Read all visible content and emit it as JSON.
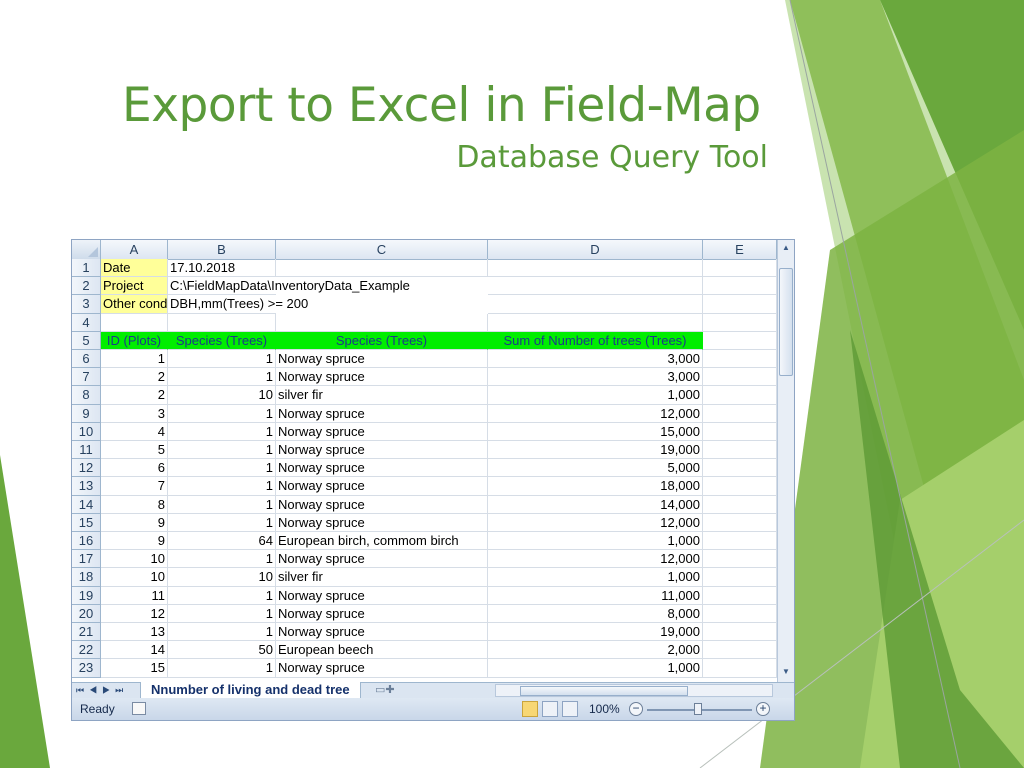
{
  "slide": {
    "title": "Export to Excel in Field-Map",
    "subtitle": "Database Query Tool"
  },
  "colors": {
    "accent": "#5a9a3a",
    "header_fill": "#00ee00",
    "meta_fill": "#ffff99"
  },
  "sheet": {
    "column_headers": [
      "A",
      "B",
      "C",
      "D",
      "E"
    ],
    "meta": {
      "date_label": "Date",
      "date_value": "17.10.2018",
      "project_label": "Project",
      "project_value": "C:\\FieldMapData\\InventoryData_Example",
      "cond_label": "Other cond",
      "cond_value": "DBH,mm(Trees) >= 200"
    },
    "table_headers": [
      "ID (Plots)",
      "Species (Trees)",
      "Species (Trees)",
      "Sum of Number of trees (Trees)"
    ],
    "rows": [
      {
        "n": "6",
        "id": "1",
        "code": "1",
        "species": "Norway spruce",
        "sum": "3,000"
      },
      {
        "n": "7",
        "id": "2",
        "code": "1",
        "species": "Norway spruce",
        "sum": "3,000"
      },
      {
        "n": "8",
        "id": "2",
        "code": "10",
        "species": "silver fir",
        "sum": "1,000"
      },
      {
        "n": "9",
        "id": "3",
        "code": "1",
        "species": "Norway spruce",
        "sum": "12,000"
      },
      {
        "n": "10",
        "id": "4",
        "code": "1",
        "species": "Norway spruce",
        "sum": "15,000"
      },
      {
        "n": "11",
        "id": "5",
        "code": "1",
        "species": "Norway spruce",
        "sum": "19,000"
      },
      {
        "n": "12",
        "id": "6",
        "code": "1",
        "species": "Norway spruce",
        "sum": "5,000"
      },
      {
        "n": "13",
        "id": "7",
        "code": "1",
        "species": "Norway spruce",
        "sum": "18,000"
      },
      {
        "n": "14",
        "id": "8",
        "code": "1",
        "species": "Norway spruce",
        "sum": "14,000"
      },
      {
        "n": "15",
        "id": "9",
        "code": "1",
        "species": "Norway spruce",
        "sum": "12,000"
      },
      {
        "n": "16",
        "id": "9",
        "code": "64",
        "species": "European birch, commom birch",
        "sum": "1,000"
      },
      {
        "n": "17",
        "id": "10",
        "code": "1",
        "species": "Norway spruce",
        "sum": "12,000"
      },
      {
        "n": "18",
        "id": "10",
        "code": "10",
        "species": "silver fir",
        "sum": "1,000"
      },
      {
        "n": "19",
        "id": "11",
        "code": "1",
        "species": "Norway spruce",
        "sum": "11,000"
      },
      {
        "n": "20",
        "id": "12",
        "code": "1",
        "species": "Norway spruce",
        "sum": "8,000"
      },
      {
        "n": "21",
        "id": "13",
        "code": "1",
        "species": "Norway spruce",
        "sum": "19,000"
      },
      {
        "n": "22",
        "id": "14",
        "code": "50",
        "species": "European beech",
        "sum": "2,000"
      },
      {
        "n": "23",
        "id": "15",
        "code": "1",
        "species": "Norway spruce",
        "sum": "1,000"
      }
    ]
  },
  "tabs": {
    "sheet_name": "Nnumber of living and dead tree"
  },
  "status": {
    "ready": "Ready",
    "zoom": "100%"
  }
}
